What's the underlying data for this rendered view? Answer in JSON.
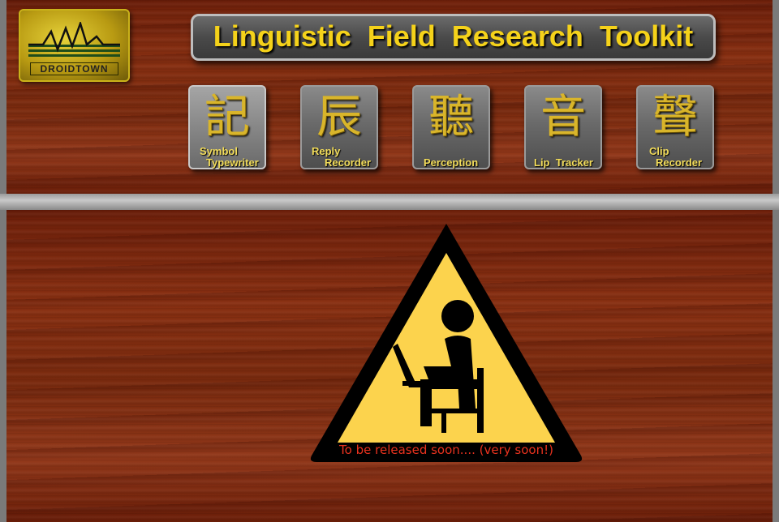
{
  "app": {
    "title": "Linguistic Field Research Toolkit",
    "logo_text": "DROIDTOWN"
  },
  "tools": [
    {
      "glyph": "記",
      "label_line1": "Symbol",
      "label_line2": "Typewriter",
      "icon": "symbol-typewriter-icon"
    },
    {
      "glyph": "⾠",
      "label_line1": "Reply",
      "label_line2": "Recorder",
      "icon": "reply-recorder-icon"
    },
    {
      "glyph": "聽",
      "label_line1": "",
      "label_line2": "Perception",
      "icon": "perception-icon"
    },
    {
      "glyph": "⾳",
      "label_line1": "",
      "label_line2": "Lip  Tracker",
      "icon": "lip-tracker-icon"
    },
    {
      "glyph": "聲",
      "label_line1": "Clip",
      "label_line2": "Recorder",
      "icon": "clip-recorder-icon"
    }
  ],
  "main": {
    "status_text": "To be released soon.... (very soon!)",
    "sign_icon": "under-construction-warning-icon"
  },
  "colors": {
    "accent_gold": "#f5d21a",
    "sign_yellow": "#fcd34d",
    "status_red": "#e8321e"
  }
}
